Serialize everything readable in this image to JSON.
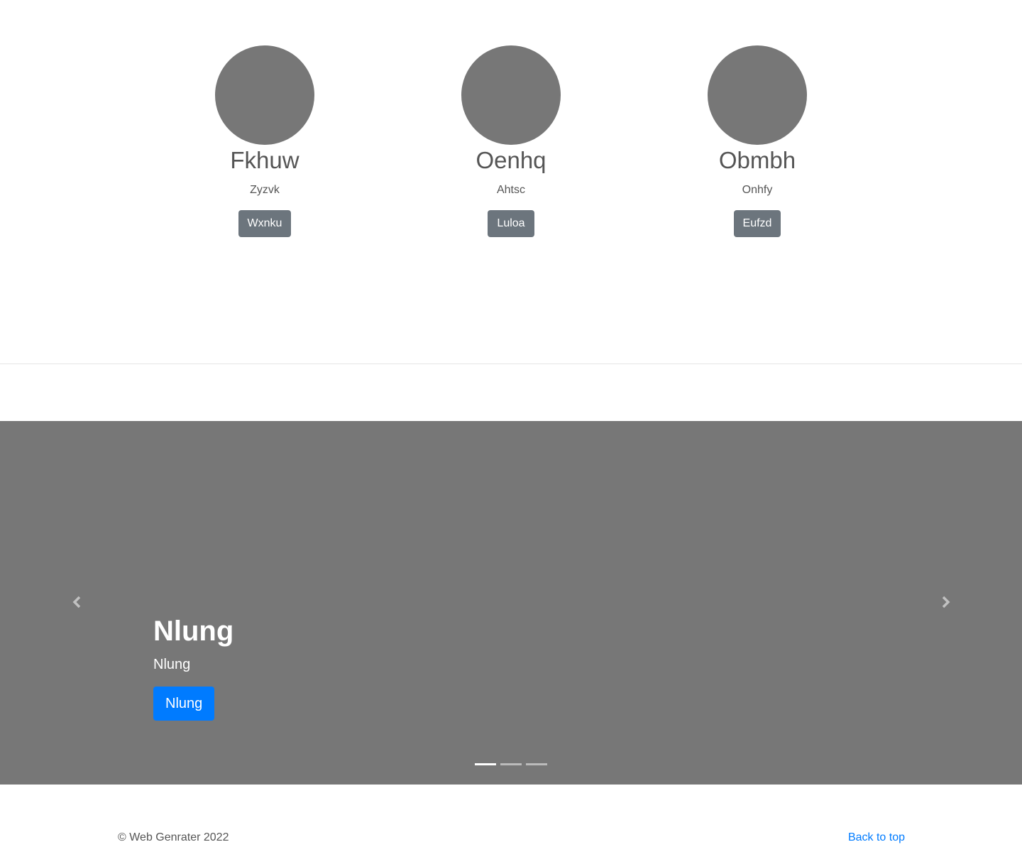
{
  "team": {
    "members": [
      {
        "name": "Fkhuw",
        "role": "Zyzvk",
        "button": "Wxnku"
      },
      {
        "name": "Oenhq",
        "role": "Ahtsc",
        "button": "Luloa"
      },
      {
        "name": "Obmbh",
        "role": "Onhfy",
        "button": "Eufzd"
      }
    ]
  },
  "carousel": {
    "title": "Nlung",
    "text": "Nlung",
    "button": "Nlung",
    "prev_icon": "chevron-left-icon",
    "next_icon": "chevron-right-icon",
    "indicator_count": 3,
    "active_index": 0
  },
  "footer": {
    "copyright": "© Web Genrater 2022",
    "back_to_top": "Back to top"
  },
  "colors": {
    "placeholder": "#777777",
    "secondary_button": "#6c757d",
    "primary_button": "#007bff"
  }
}
